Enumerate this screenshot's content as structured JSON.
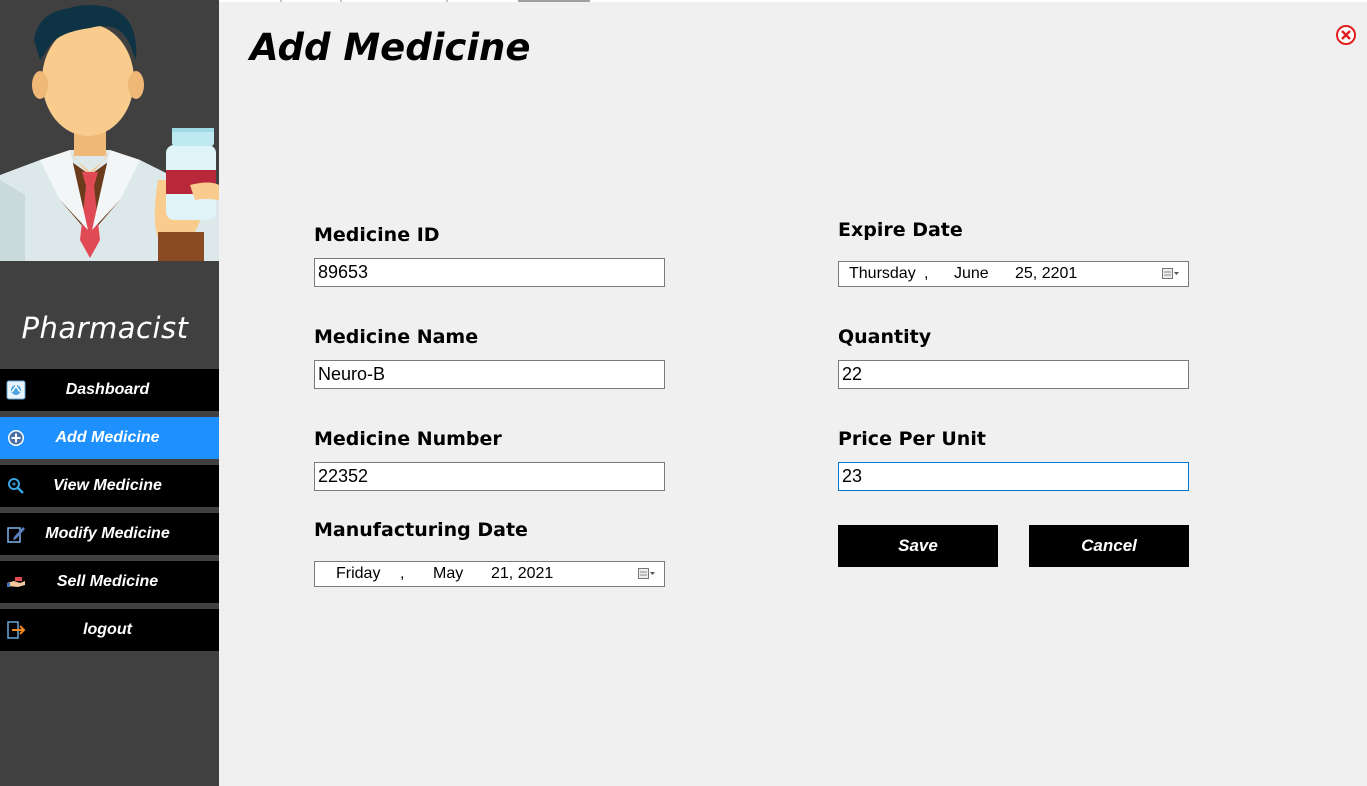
{
  "sidebar": {
    "role": "Pharmacist",
    "items": [
      {
        "label": "Dashboard",
        "icon": "dashboard-icon"
      },
      {
        "label": "Add Medicine",
        "icon": "plus-circle-icon",
        "active": true
      },
      {
        "label": "View Medicine",
        "icon": "magnifier-icon"
      },
      {
        "label": "Modify Medicine",
        "icon": "edit-icon"
      },
      {
        "label": "Sell Medicine",
        "icon": "sell-icon"
      },
      {
        "label": "logout",
        "icon": "logout-icon"
      }
    ],
    "active_color": "#1e90ff"
  },
  "page": {
    "title": "Add Medicine"
  },
  "form": {
    "medicine_id": {
      "label": "Medicine ID",
      "value": "89653"
    },
    "medicine_name": {
      "label": "Medicine Name",
      "value": "Neuro-B"
    },
    "medicine_number": {
      "label": "Medicine Number",
      "value": "22352"
    },
    "manufacturing_date": {
      "label": "Manufacturing Date",
      "weekday": "Friday",
      "sep": ",",
      "month": "May",
      "daydate": "21, 2021"
    },
    "expire_date": {
      "label": "Expire Date",
      "weekday": "Thursday",
      "sep": ",",
      "month": "June",
      "daydate": "25, 2201"
    },
    "quantity": {
      "label": "Quantity",
      "value": "22"
    },
    "price_per_unit": {
      "label": "Price Per Unit",
      "value": "23"
    }
  },
  "buttons": {
    "save": "Save",
    "cancel": "Cancel"
  }
}
